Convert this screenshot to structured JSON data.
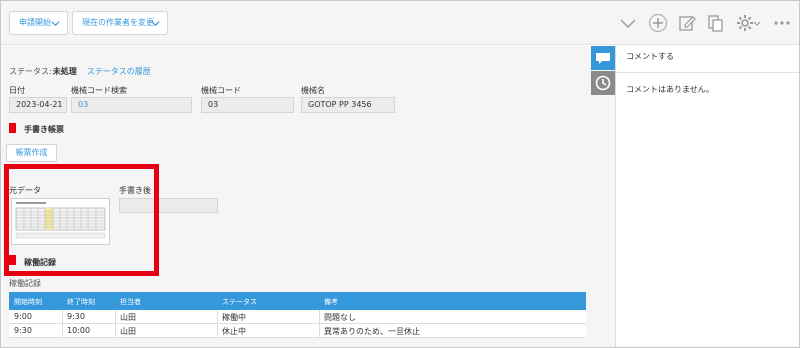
{
  "toolbar": {
    "start_label": "申請開始",
    "change_assignee_label": "現在の作業者を変更"
  },
  "record": {
    "status_label": "ステータス:",
    "status_value": "未処理",
    "history_link": "ステータスの履歴",
    "fields": {
      "date": {
        "label": "日付",
        "value": "2023-04-21"
      },
      "machine_code_search": {
        "label": "機械コード検索",
        "value": "03"
      },
      "machine_code": {
        "label": "機械コード",
        "value": "03"
      },
      "machine_name": {
        "label": "機械名",
        "value": "GOTOP PP 3456"
      }
    },
    "handwritten_form_label": "手書き帳票",
    "create_form_button": "帳票作成",
    "original_data_label": "元データ",
    "after_handwriting_label": "手書き後",
    "operation_record_label": "稼働記録",
    "operation_record_title": "稼働記録"
  },
  "table": {
    "headers": [
      "開始時刻",
      "終了時刻",
      "担当者",
      "ステータス",
      "備考"
    ],
    "rows": [
      [
        "9:00",
        "9:30",
        "山田",
        "稼働中",
        "問題なし"
      ],
      [
        "9:30",
        "10:00",
        "山田",
        "休止中",
        "異常ありのため、一旦休止"
      ]
    ]
  },
  "comments": {
    "title": "コメントする",
    "empty_message": "コメントはありません。"
  },
  "colors": {
    "accent": "#3498db",
    "highlight": "#e60012"
  },
  "icons": [
    "chevron-down-icon",
    "plus-icon",
    "edit-icon",
    "copy-icon",
    "gear-icon",
    "comment-icon",
    "history-icon"
  ]
}
